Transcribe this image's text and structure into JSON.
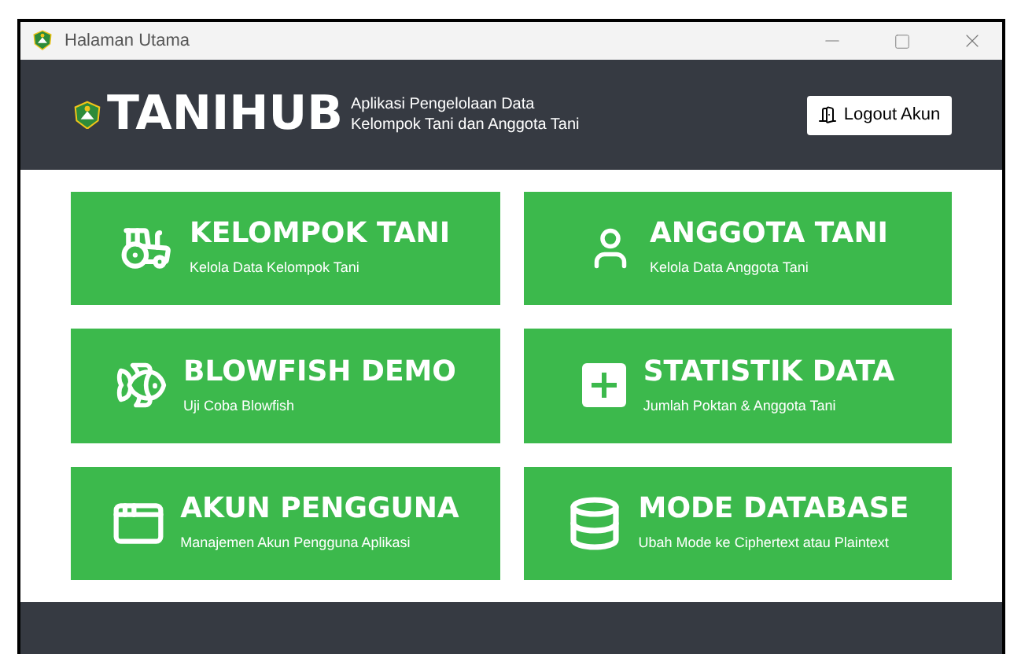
{
  "window": {
    "title": "Halaman Utama"
  },
  "header": {
    "logo": "TANIHUB",
    "tagline_1": "Aplikasi Pengelolaan Data",
    "tagline_2": "Kelompok Tani dan Anggota Tani",
    "logout": "Logout Akun"
  },
  "menu": [
    {
      "title": "KELOMPOK TANI",
      "subtitle": "Kelola Data Kelompok Tani"
    },
    {
      "title": "ANGGOTA TANI",
      "subtitle": "Kelola Data Anggota Tani"
    },
    {
      "title": "BLOWFISH DEMO",
      "subtitle": "Uji Coba Blowfish"
    },
    {
      "title": "STATISTIK DATA",
      "subtitle": "Jumlah Poktan & Anggota Tani"
    },
    {
      "title": "AKUN PENGGUNA",
      "subtitle": "Manajemen Akun Pengguna Aplikasi"
    },
    {
      "title": "MODE DATABASE",
      "subtitle": "Ubah Mode ke Ciphertext atau Plaintext"
    }
  ]
}
